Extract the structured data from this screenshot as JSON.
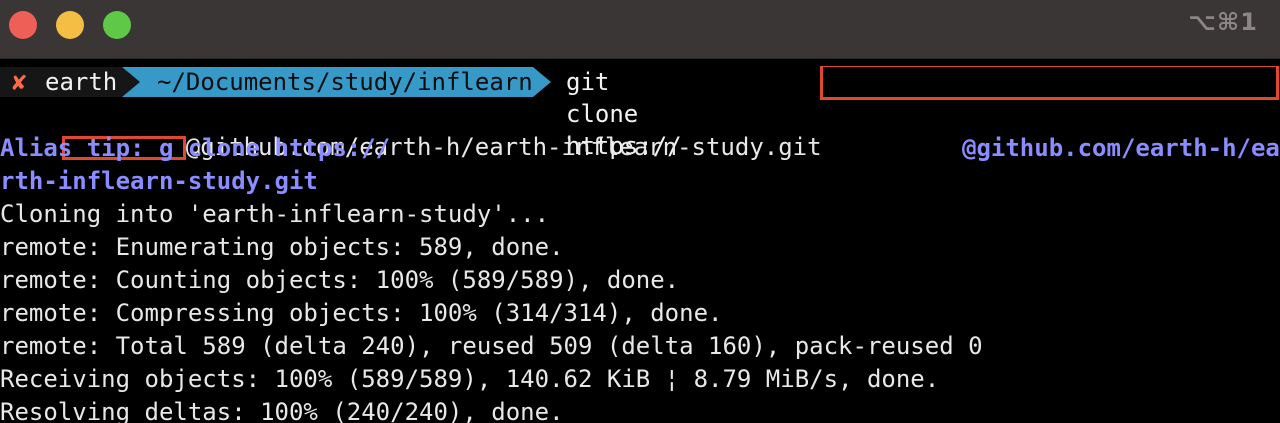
{
  "window": {
    "shortcut": "⌥⌘1"
  },
  "prompt": {
    "status_mark": "✘",
    "host": "earth",
    "cwd": "~/Documents/study/inflearn",
    "command": "git clone https://"
  },
  "output": {
    "line_url_tail": "@github.com/earth-h/earth-inflearn-study.git",
    "alias_tip_left": "Alias tip: g clone https://",
    "alias_tip_right": "@github.com/earth-h/ea",
    "alias_tip_wrap": "rth-inflearn-study.git",
    "lines": [
      "Cloning into 'earth-inflearn-study'...",
      "remote: Enumerating objects: 589, done.",
      "remote: Counting objects: 100% (589/589), done.",
      "remote: Compressing objects: 100% (314/314), done.",
      "remote: Total 589 (delta 240), reused 509 (delta 160), pack-reused 0",
      "Receiving objects: 100% (589/589), 140.62 KiB ¦ 8.79 MiB/s, done.",
      "Resolving deltas: 100% (240/240), done."
    ]
  },
  "colors": {
    "titlebar": "#3b3636",
    "prompt_segment": "#3799c8",
    "alias_tip": "#8b8cff",
    "redaction_border": "#e0492f"
  }
}
